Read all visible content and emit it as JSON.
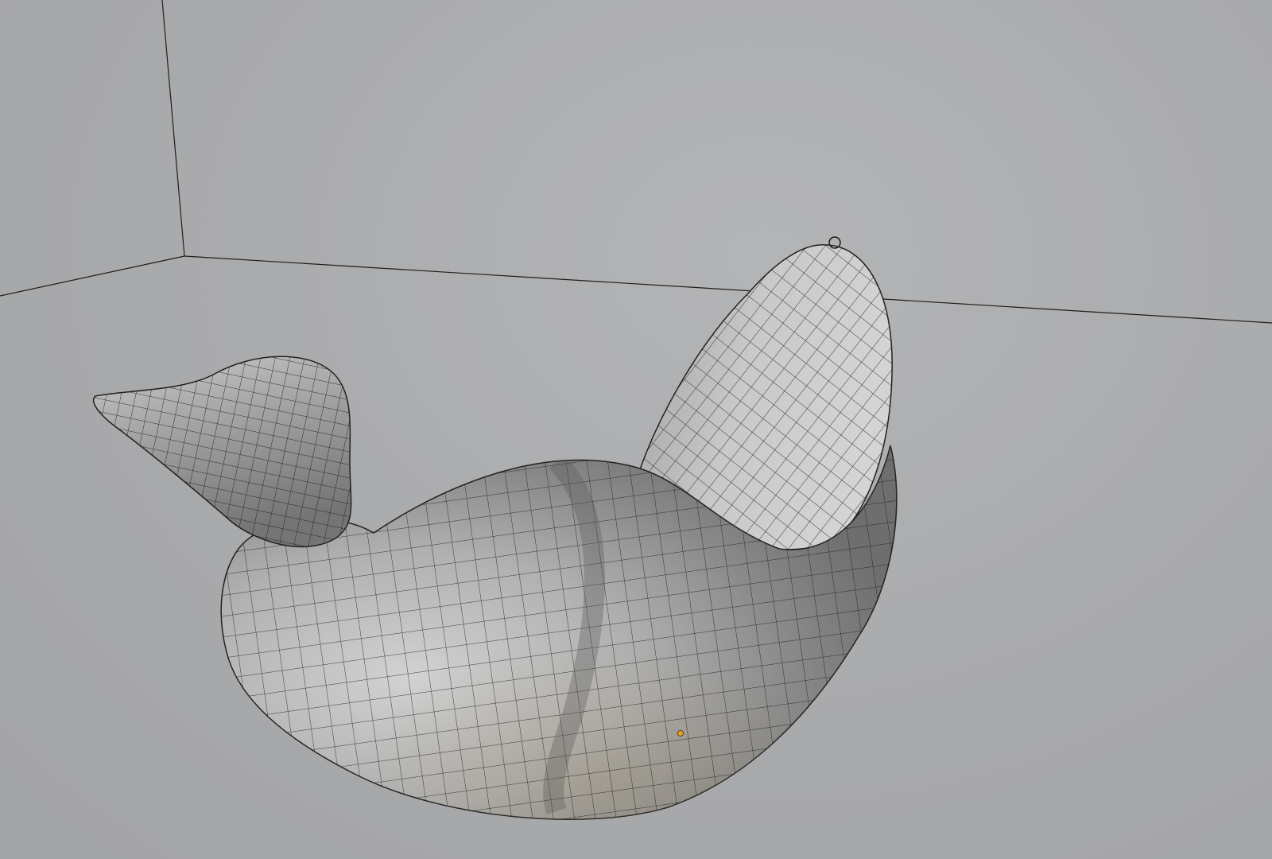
{
  "viewport": {
    "background": "#a9aaac",
    "shading": "solid",
    "overlay": "wireframe",
    "object_color": "#b8b8b8",
    "wire_color": "#141414",
    "selected_vertex_color": "#f0a020"
  },
  "object": {
    "kind": "sculpted-mesh",
    "topology": "quad-grid"
  },
  "icons": {
    "origin_marker": "origin-dot-icon"
  }
}
